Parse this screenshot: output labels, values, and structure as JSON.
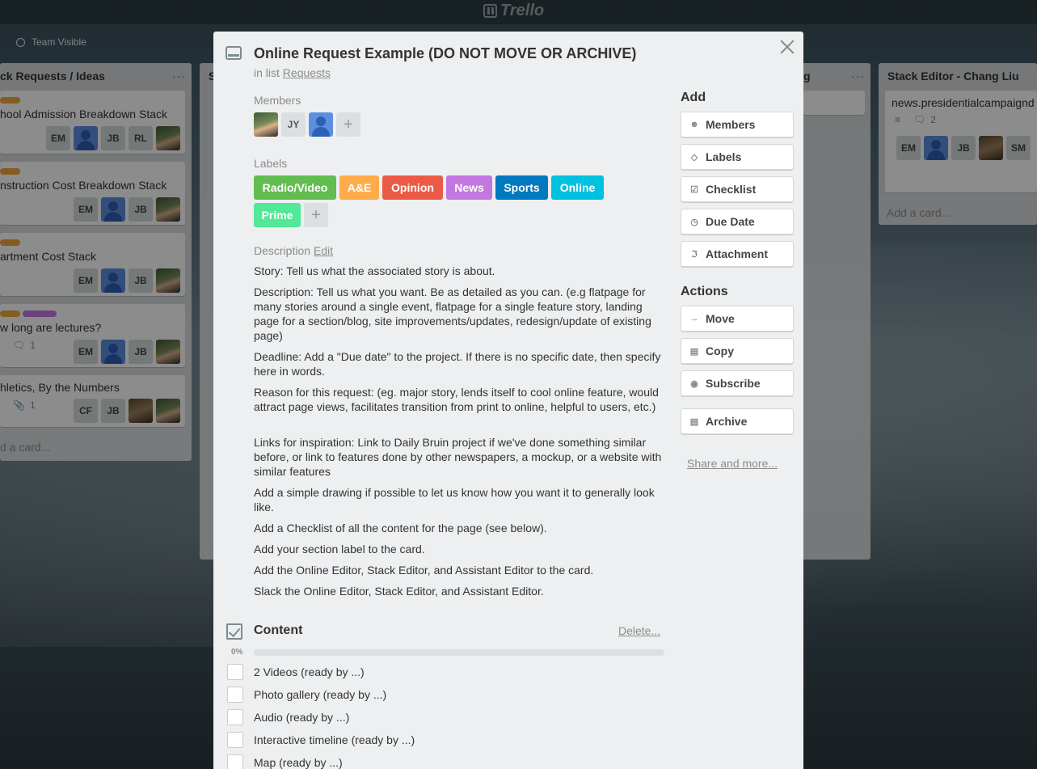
{
  "app": {
    "logo_text": "Trello"
  },
  "board": {
    "visibility": "Team Visible"
  },
  "lists": {
    "left": {
      "title": "ck Requests / Ideas",
      "menu": "···",
      "cards": [
        {
          "title": "hool Admission Breakdown Stack",
          "members": [
            "EM",
            "JB",
            "RL"
          ]
        },
        {
          "title": "nstruction Cost Breakdown Stack",
          "members": [
            "EM",
            "JB"
          ]
        },
        {
          "title": "artment Cost Stack",
          "members": [
            "EM",
            "JB"
          ]
        },
        {
          "title": "w long are lectures?",
          "comments": "1",
          "members": [
            "EM",
            "JB"
          ]
        },
        {
          "title": "hletics, By the Numbers",
          "attachments": "1",
          "members": [
            "CF",
            "JB"
          ]
        }
      ],
      "add_card": "d a card..."
    },
    "middle": {
      "title": "S",
      "partial_title": "g",
      "menu": "···"
    },
    "right": {
      "title": "Stack Editor - Chang Liu",
      "menu": "···",
      "card_title": "news.presidentialcampaignd",
      "comments": "2",
      "members": [
        "EM",
        "JB",
        "SM"
      ],
      "add_card": "Add a card..."
    }
  },
  "modal": {
    "title": "Online Request Example (DO NOT MOVE OR ARCHIVE)",
    "in_list_prefix": "in list",
    "list_name": "Requests",
    "members_label": "Members",
    "member_initials": "JY",
    "labels_label": "Labels",
    "labels": [
      {
        "name": "Radio/Video",
        "color": "#61bd4f"
      },
      {
        "name": "A&E",
        "color": "#ffab4a"
      },
      {
        "name": "Opinion",
        "color": "#eb5a46"
      },
      {
        "name": "News",
        "color": "#c377e0"
      },
      {
        "name": "Sports",
        "color": "#0079bf"
      },
      {
        "name": "Online",
        "color": "#00c2e0"
      },
      {
        "name": "Prime",
        "color": "#51e898"
      }
    ],
    "plus": "+",
    "description_label": "Description",
    "edit_label": "Edit",
    "description": [
      "Story: Tell us what the associated story is about.",
      "Description: Tell us what you want. Be as detailed as you can. (e.g flatpage for many stories around a single event, flatpage for a single feature story, landing page for a section/blog, site improvements/updates, redesign/update of existing page)",
      "Deadline: Add a \"Due date\" to the project. If there is no specific date, then specify here in words.",
      "Reason for this request: (eg. major story, lends itself to cool online feature, would attract page views, facilitates transition from print to online, helpful to users, etc.)",
      "Links for inspiration: Link to Daily Bruin project if we've done something similar before, or link to features done by other newspapers, a mockup, or a website with similar features",
      "Add a simple drawing if possible to let us know how you want it to generally look like.",
      "Add a Checklist of all the content for the page (see below).",
      "Add your section label to the card.",
      "Add the Online Editor, Stack Editor, and Assistant Editor to the card.",
      "Slack the Online Editor, Stack Editor, and Assistant Editor."
    ],
    "checklist": {
      "title": "Content",
      "delete_label": "Delete...",
      "progress_text": "0%",
      "progress_fraction": 0,
      "items": [
        "2 Videos (ready by ...)",
        "Photo gallery (ready by ...)",
        "Audio (ready by ...)",
        "Interactive timeline (ready by ...)",
        "Map (ready by ...)"
      ]
    },
    "sidebar": {
      "add_heading": "Add",
      "add_buttons": [
        "Members",
        "Labels",
        "Checklist",
        "Due Date",
        "Attachment"
      ],
      "actions_heading": "Actions",
      "action_buttons": [
        "Move",
        "Copy",
        "Subscribe"
      ],
      "archive_label": "Archive",
      "share_label": "Share and more..."
    }
  }
}
